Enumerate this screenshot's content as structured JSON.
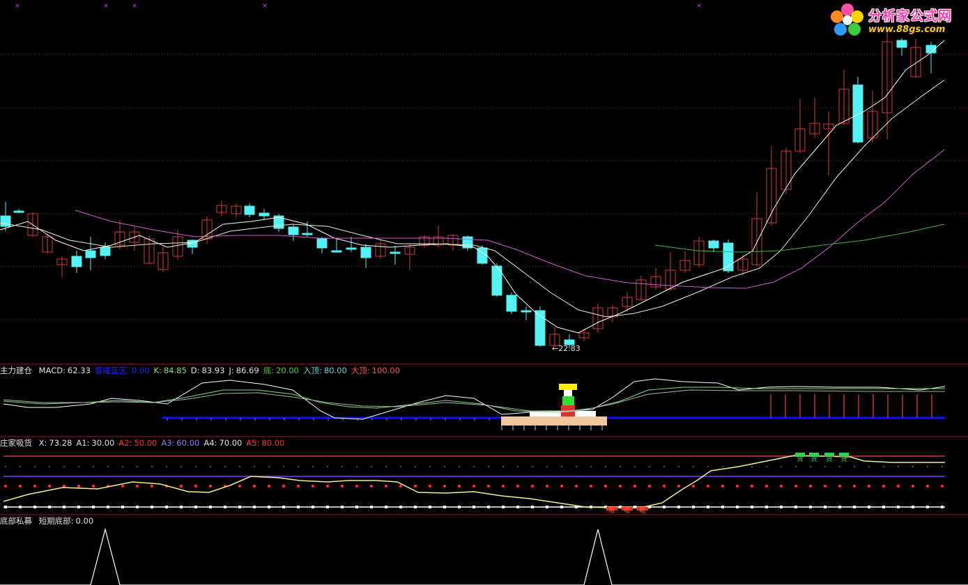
{
  "watermark": {
    "title": "分析家公式网",
    "url": "www.88gs.com",
    "icon": "flower-logo-icon"
  },
  "colors": {
    "background": "#000000",
    "grid": "#8b1a1a",
    "up_candle": "#d33a3a",
    "down_candle": "#54f2f2",
    "ma_short": "#ffffff",
    "ma_mid": "#f0f0c8",
    "ma_long": "#d65cd6",
    "ma_longest": "#3fb43f"
  },
  "main_panel": {
    "low_annotation": "←22.83"
  },
  "indicator1": {
    "name": "主力建仓",
    "items": [
      {
        "label": "MACD:",
        "value": "62.33",
        "color": "#e0e0e0"
      },
      {
        "label": "警戒蓝区:",
        "value": "0.00",
        "color": "#2222ff"
      },
      {
        "label": "K:",
        "value": "84.85",
        "color": "#7fe07f"
      },
      {
        "label": "D:",
        "value": "83.93",
        "color": "#e0e0e0"
      },
      {
        "label": "J:",
        "value": "86.69",
        "color": "#e0e0e0"
      },
      {
        "label": "底:",
        "value": "20.00",
        "color": "#3fd03f"
      },
      {
        "label": "入顶:",
        "value": "80.00",
        "color": "#54d8d8"
      },
      {
        "label": "大顶:",
        "value": "100.00",
        "color": "#ff5050"
      }
    ]
  },
  "indicator2": {
    "name": "庄家吸货",
    "items": [
      {
        "label": "X:",
        "value": "73.28",
        "color": "#e0e0e0"
      },
      {
        "label": "A1:",
        "value": "30.00",
        "color": "#e0e0e0"
      },
      {
        "label": "A2:",
        "value": "50.00",
        "color": "#ff3030"
      },
      {
        "label": "A3:",
        "value": "60.00",
        "color": "#8080ff"
      },
      {
        "label": "A4:",
        "value": "70.00",
        "color": "#e0e0e0"
      },
      {
        "label": "A5:",
        "value": "80.00",
        "color": "#ff3030"
      }
    ],
    "buy_marker": "吸",
    "sell_marker": "货"
  },
  "indicator3": {
    "name": "底部私募",
    "items": [
      {
        "label": "短期底部:",
        "value": "0.00",
        "color": "#e0e0e0"
      }
    ]
  }
}
